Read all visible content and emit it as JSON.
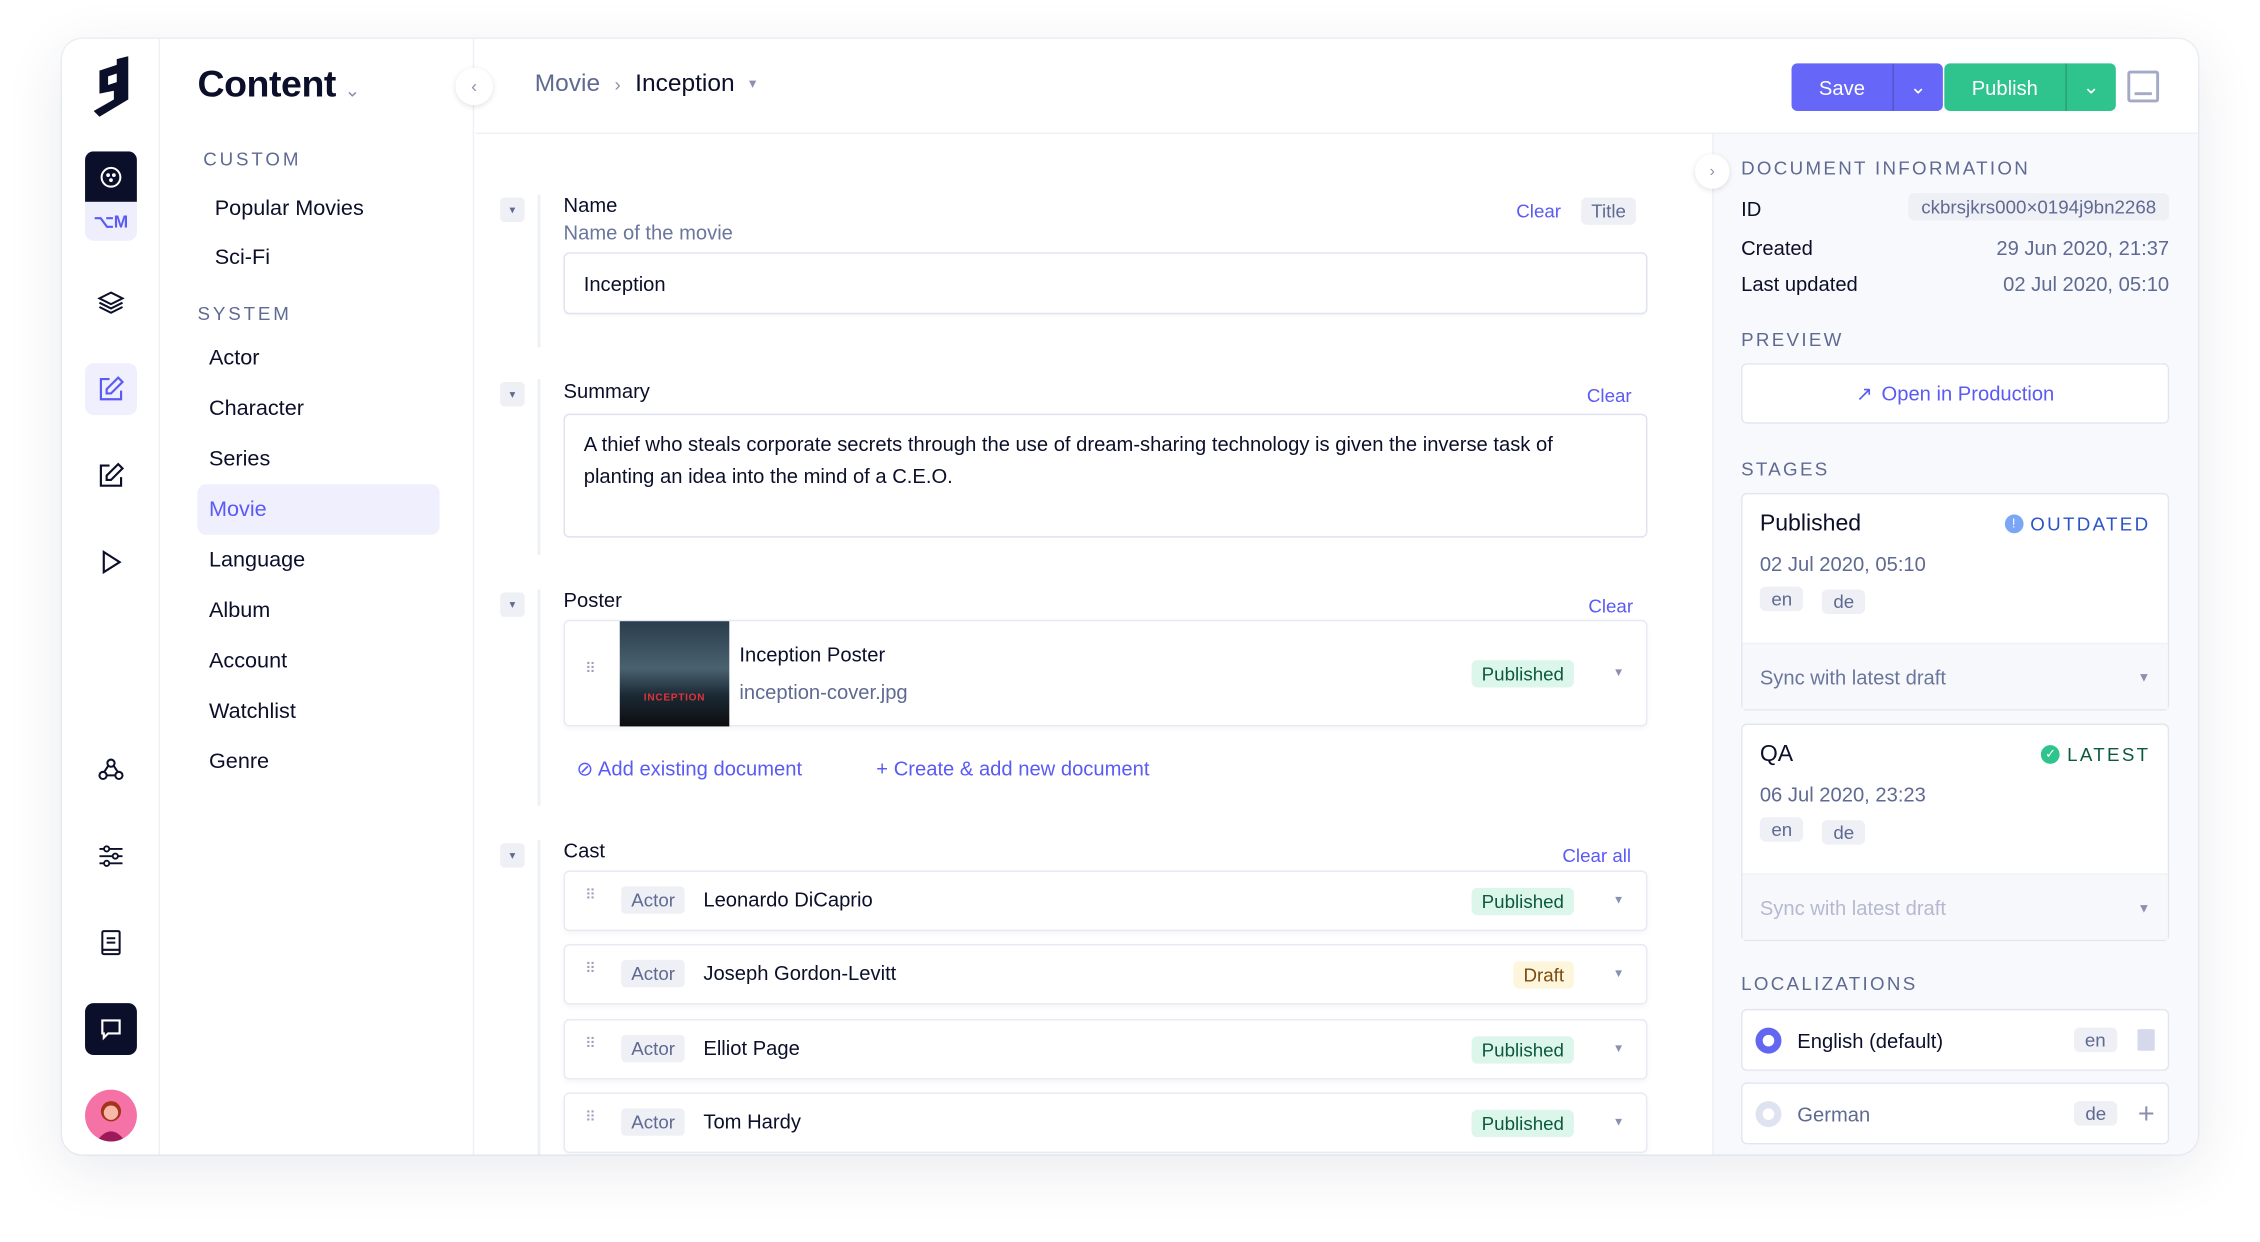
{
  "app": {
    "section_title": "Content"
  },
  "rail": {
    "project_badge": "⌥M",
    "icons": [
      "project-icon",
      "layers-icon",
      "content-edit-icon",
      "edit-icon",
      "play-icon",
      "webhooks-icon",
      "settings-sliders-icon",
      "docs-book-icon",
      "chat-icon",
      "user-avatar"
    ]
  },
  "nav": {
    "custom_header": "CUSTOM",
    "custom_items": [
      "Popular Movies",
      "Sci-Fi"
    ],
    "system_header": "SYSTEM",
    "system_items": [
      "Actor",
      "Character",
      "Series",
      "Movie",
      "Language",
      "Album",
      "Account",
      "Watchlist",
      "Genre"
    ],
    "active_item": "Movie"
  },
  "breadcrumb": {
    "model": "Movie",
    "document": "Inception"
  },
  "toolbar": {
    "save_label": "Save",
    "publish_label": "Publish",
    "colors": {
      "save": "#6666f8",
      "publish": "#2fc48d"
    }
  },
  "fields": {
    "name": {
      "label": "Name",
      "description": "Name of the movie",
      "value": "Inception",
      "clear_label": "Clear",
      "title_tag": "Title"
    },
    "summary": {
      "label": "Summary",
      "value": "A thief who steals corporate secrets through the use of dream-sharing technology is given the inverse task of planting an idea into the mind of a C.E.O.",
      "clear_label": "Clear"
    },
    "poster": {
      "label": "Poster",
      "clear_label": "Clear",
      "asset": {
        "title": "Inception Poster",
        "filename": "inception-cover.jpg",
        "status": "Published",
        "thumbnail_text": "INCEPTION"
      },
      "add_existing_label": "Add existing document",
      "create_new_label": "Create & add new document"
    },
    "cast": {
      "label": "Cast",
      "clear_label": "Clear all",
      "items": [
        {
          "type": "Actor",
          "name": "Leonardo DiCaprio",
          "status": "Published"
        },
        {
          "type": "Actor",
          "name": "Joseph Gordon-Levitt",
          "status": "Draft"
        },
        {
          "type": "Actor",
          "name": "Elliot Page",
          "status": "Published"
        },
        {
          "type": "Actor",
          "name": "Tom Hardy",
          "status": "Published"
        }
      ]
    }
  },
  "sidebar": {
    "doc_info_header": "DOCUMENT INFORMATION",
    "id_label": "ID",
    "id_value": "ckbrsjkrs000×0194j9bn2268",
    "created_label": "Created",
    "created_value": "29 Jun 2020, 21:37",
    "updated_label": "Last updated",
    "updated_value": "02 Jul 2020, 05:10",
    "preview_header": "PREVIEW",
    "open_production_label": "Open in Production",
    "stages_header": "STAGES",
    "stages": [
      {
        "name": "Published",
        "status": "OUTDATED",
        "date": "02 Jul 2020, 05:10",
        "locales": [
          "en",
          "de"
        ],
        "sync_label": "Sync with latest draft"
      },
      {
        "name": "QA",
        "status": "LATEST",
        "date": "06 Jul 2020, 23:23",
        "locales": [
          "en",
          "de"
        ],
        "sync_label": "Sync with latest draft"
      }
    ],
    "localizations_header": "LOCALIZATIONS",
    "localizations": [
      {
        "name": "English (default)",
        "code": "en",
        "enabled": true
      },
      {
        "name": "German",
        "code": "de",
        "enabled": false
      }
    ]
  }
}
